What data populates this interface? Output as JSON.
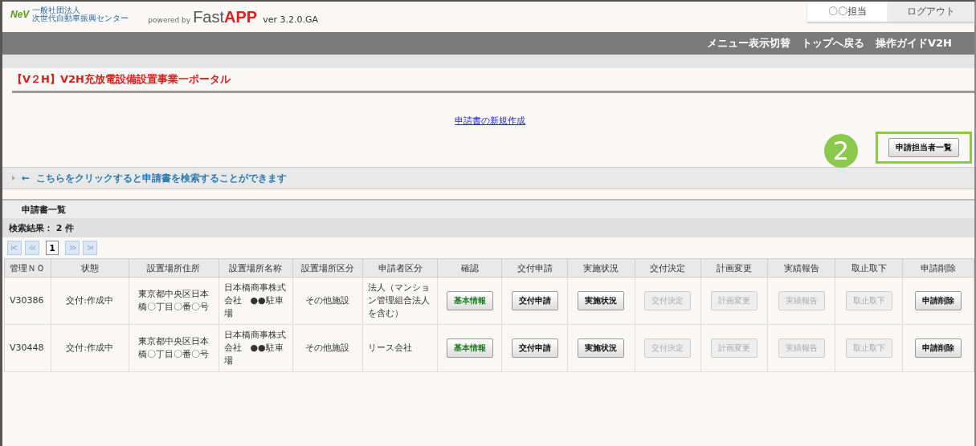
{
  "header": {
    "logo": {
      "mark": "NeV",
      "org_line1": "一般社団法人",
      "org_line2": "次世代自動車振興センター"
    },
    "powered_by": "powered by",
    "brand_fast": "Fast",
    "brand_app": "APP",
    "version": "ver 3.2.0.GA",
    "user": "〇〇担当",
    "logout": "ログアウト"
  },
  "nav": [
    "メニュー表示切替",
    "トップへ戻る",
    "操作ガイドV2H"
  ],
  "page_title": "【V２H】V2H充放電設備設置事業一ポータル",
  "new_link": "申請書の新規作成",
  "callout": {
    "number": "2",
    "button": "申請担当者一覧"
  },
  "search_toggle": "←  こちらをクリックすると申請書を検索することができます",
  "list_title": "申請書一覧",
  "result_count": "検索結果： 2 件",
  "pager": {
    "page": "1"
  },
  "table": {
    "columns": [
      "管理ＮＯ",
      "状態",
      "設置場所住所",
      "設置場所名称",
      "設置場所区分",
      "申請者区分",
      "確認",
      "交付申請",
      "実施状況",
      "交付決定",
      "計画変更",
      "実績報告",
      "取止取下",
      "申請削除"
    ],
    "rows": [
      {
        "cells": [
          "V30386",
          "交付:作成中",
          "東京都中央区日本橋〇丁目〇番〇号",
          "日本橋商事株式会社　●●駐車場",
          "その他施設",
          "法人（マンション管理組合法人を含む）"
        ],
        "buttons": [
          {
            "label": "基本情報",
            "kind": "info",
            "disabled": false
          },
          {
            "label": "交付申請",
            "kind": "action",
            "disabled": false
          },
          {
            "label": "実施状況",
            "kind": "action",
            "disabled": false
          },
          {
            "label": "交付決定",
            "kind": "action",
            "disabled": true
          },
          {
            "label": "計画変更",
            "kind": "action",
            "disabled": true
          },
          {
            "label": "実績報告",
            "kind": "action",
            "disabled": true
          },
          {
            "label": "取止取下",
            "kind": "action",
            "disabled": true
          },
          {
            "label": "申請削除",
            "kind": "action",
            "disabled": false
          }
        ]
      },
      {
        "cells": [
          "V30448",
          "交付:作成中",
          "東京都中央区日本橋〇丁目〇番〇号",
          "日本橋商事株式会社　●●駐車場",
          "その他施設",
          "リース会社"
        ],
        "buttons": [
          {
            "label": "基本情報",
            "kind": "info",
            "disabled": false
          },
          {
            "label": "交付申請",
            "kind": "action",
            "disabled": false
          },
          {
            "label": "実施状況",
            "kind": "action",
            "disabled": false
          },
          {
            "label": "交付決定",
            "kind": "action",
            "disabled": true
          },
          {
            "label": "計画変更",
            "kind": "action",
            "disabled": true
          },
          {
            "label": "実績報告",
            "kind": "action",
            "disabled": true
          },
          {
            "label": "取止取下",
            "kind": "action",
            "disabled": true
          },
          {
            "label": "申請削除",
            "kind": "action",
            "disabled": false
          }
        ]
      }
    ]
  }
}
